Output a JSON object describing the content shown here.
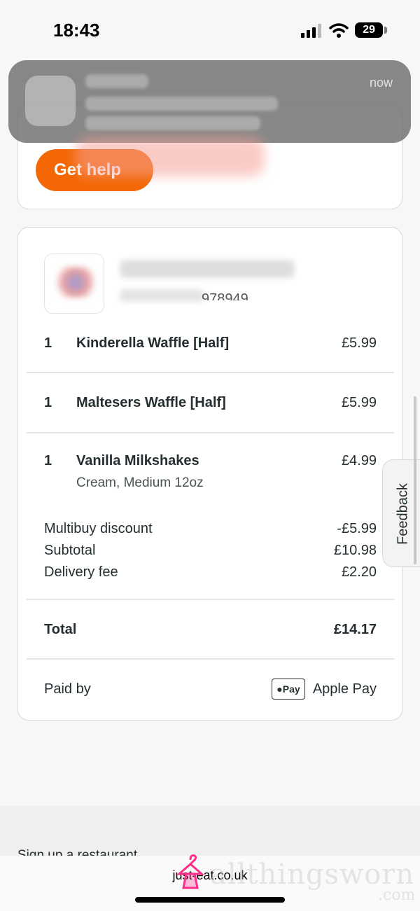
{
  "status_bar": {
    "time": "18:43",
    "battery": "29"
  },
  "notification": {
    "time": "now"
  },
  "help": {
    "button_label": "Get help"
  },
  "restaurant": {
    "code_fragment": "978949"
  },
  "items": [
    {
      "qty": "1",
      "name": "Kinderella Waffle [Half]",
      "options": "",
      "price": "£5.99"
    },
    {
      "qty": "1",
      "name": "Maltesers Waffle [Half]",
      "options": "",
      "price": "£5.99"
    },
    {
      "qty": "1",
      "name": "Vanilla Milkshakes",
      "options": "Cream, Medium 12oz",
      "price": "£4.99"
    }
  ],
  "summary": {
    "multibuy_label": "Multibuy discount",
    "multibuy_value": "-£5.99",
    "subtotal_label": "Subtotal",
    "subtotal_value": "£10.98",
    "delivery_label": "Delivery fee",
    "delivery_value": "£2.20",
    "total_label": "Total",
    "total_value": "£14.17"
  },
  "payment": {
    "label": "Paid by",
    "badge": "Pay",
    "method": "Apple Pay"
  },
  "feedback": {
    "label": "Feedback"
  },
  "footer": {
    "link": "Sign up a restaurant"
  },
  "browser": {
    "url": "just-eat.co.uk"
  },
  "watermark": {
    "text": "allthingsworn",
    "suffix": ".com"
  },
  "colors": {
    "accent": "#f36805",
    "watermark_pink": "#ff2d8a"
  }
}
